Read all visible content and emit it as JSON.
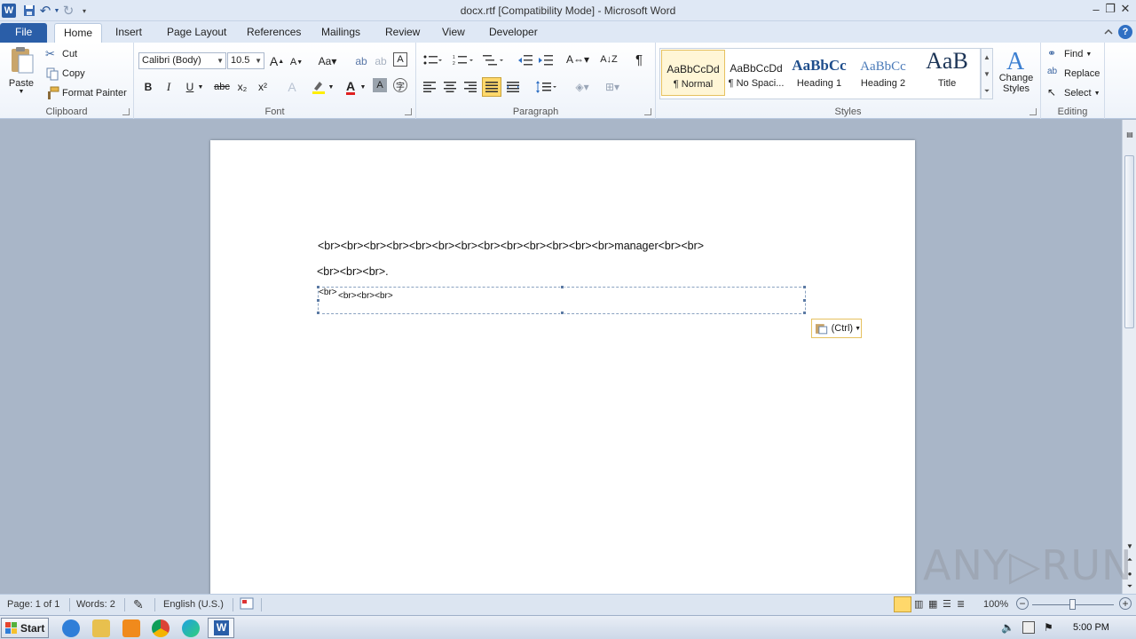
{
  "window": {
    "title": "docx.rtf [Compatibility Mode]  -  Microsoft Word",
    "minimize_icon": "minimize-icon",
    "maximize_icon": "restore-icon",
    "close_icon": "close-icon"
  },
  "tabs": {
    "file": "File",
    "home": "Home",
    "insert": "Insert",
    "page_layout": "Page Layout",
    "references": "References",
    "mailings": "Mailings",
    "review": "Review",
    "view": "View",
    "developer": "Developer"
  },
  "ribbon": {
    "clipboard": {
      "label": "Clipboard",
      "paste": "Paste",
      "cut": "Cut",
      "copy": "Copy",
      "format_painter": "Format Painter"
    },
    "font": {
      "label": "Font",
      "font_name": "Calibri (Body)",
      "font_size": "10.5",
      "bold": "B",
      "italic": "I",
      "underline": "U",
      "strike": "abc",
      "subscript": "x₂",
      "superscript": "x²"
    },
    "paragraph": {
      "label": "Paragraph"
    },
    "styles": {
      "label": "Styles",
      "items": [
        {
          "sample": "AaBbCcDd",
          "name": "¶ Normal"
        },
        {
          "sample": "AaBbCcDd",
          "name": "¶ No Spaci..."
        },
        {
          "sample": "AaBbCc",
          "name": "Heading 1"
        },
        {
          "sample": "AaBbCc",
          "name": "Heading 2"
        },
        {
          "sample": "AaB",
          "name": "Title"
        }
      ],
      "change_styles_line1": "Change",
      "change_styles_line2": "Styles"
    },
    "editing": {
      "label": "Editing",
      "find": "Find",
      "replace": "Replace",
      "select": "Select"
    }
  },
  "document": {
    "line1": "<br><br><br><br><br><br><br><br><br><br><br><br><br>manager<br><br>",
    "line2": "<br><br><br>.",
    "textbox_first": "<br>",
    "textbox_rest": "<br><br><br>",
    "paste_options": "(Ctrl)"
  },
  "status": {
    "page": "Page: 1 of 1",
    "words": "Words: 2",
    "language": "English (U.S.)",
    "zoom": "100%",
    "zoom_level": 0.5
  },
  "taskbar": {
    "start": "Start",
    "clock": "5:00 PM"
  },
  "watermark": "ANY▷RUN",
  "colors": {
    "file_tab": "#2a5ea8",
    "ribbon_bg": "#eef3fa",
    "doc_bg": "#a9b6c8",
    "highlight": "#e6c15f"
  }
}
